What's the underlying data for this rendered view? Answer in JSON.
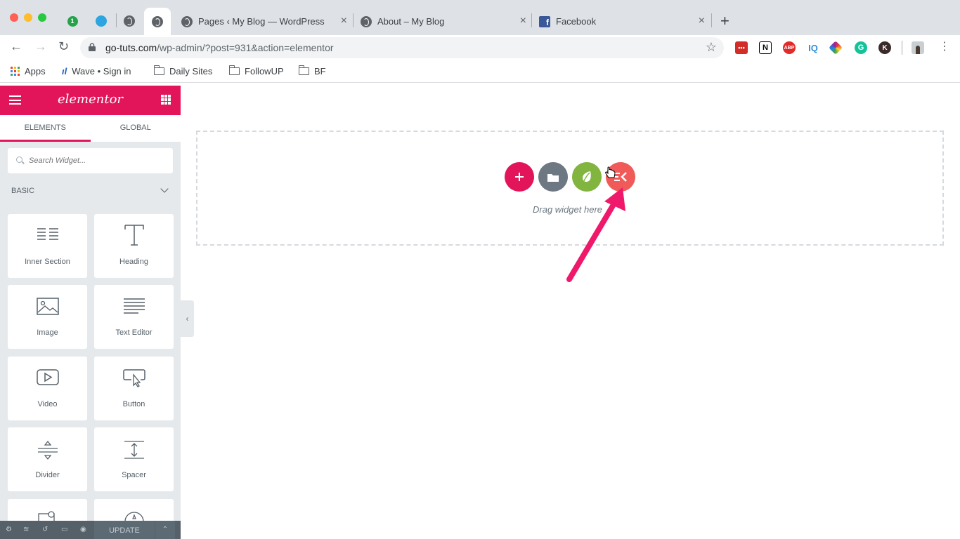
{
  "browser": {
    "tabs": [
      {
        "title": "Pages ‹ My Blog — WordPress",
        "icon": "globe-icon"
      },
      {
        "title": "About – My Blog",
        "icon": "globe-icon"
      },
      {
        "title": "Facebook",
        "icon": "facebook-icon"
      }
    ],
    "url_host": "go-tuts.com",
    "url_path": "/wp-admin/?post=931&action=elementor",
    "bookmarks": [
      {
        "label": "Apps",
        "icon": "apps-grid-icon"
      },
      {
        "label": "Wave • Sign in",
        "icon": "wave-icon"
      },
      {
        "label": "Daily Sites",
        "icon": "folder-icon"
      },
      {
        "label": "FollowUP",
        "icon": "folder-icon"
      },
      {
        "label": "BF",
        "icon": "folder-icon"
      }
    ],
    "extensions": [
      "•••",
      "N",
      "ABP",
      "IQ",
      "",
      "G",
      "K"
    ]
  },
  "panel": {
    "logo": "elementor",
    "tabs": [
      "ELEMENTS",
      "GLOBAL"
    ],
    "search_placeholder": "Search Widget...",
    "category": "BASIC",
    "widgets": [
      {
        "label": "Inner Section",
        "icon": "inner-section-icon"
      },
      {
        "label": "Heading",
        "icon": "heading-icon"
      },
      {
        "label": "Image",
        "icon": "image-icon"
      },
      {
        "label": "Text Editor",
        "icon": "text-editor-icon"
      },
      {
        "label": "Video",
        "icon": "video-icon"
      },
      {
        "label": "Button",
        "icon": "button-icon"
      },
      {
        "label": "Divider",
        "icon": "divider-icon"
      },
      {
        "label": "Spacer",
        "icon": "spacer-icon"
      }
    ],
    "update_label": "UPDATE"
  },
  "canvas": {
    "hint": "Drag widget here"
  },
  "colors": {
    "accent": "#e2155b",
    "panel_bg": "#e6e9ec",
    "add_button": "#e2155b",
    "template_button": "#6d7882",
    "envato_button": "#82b440",
    "addon_button": "#f05a59",
    "annotation_arrow": "#f0186a"
  }
}
